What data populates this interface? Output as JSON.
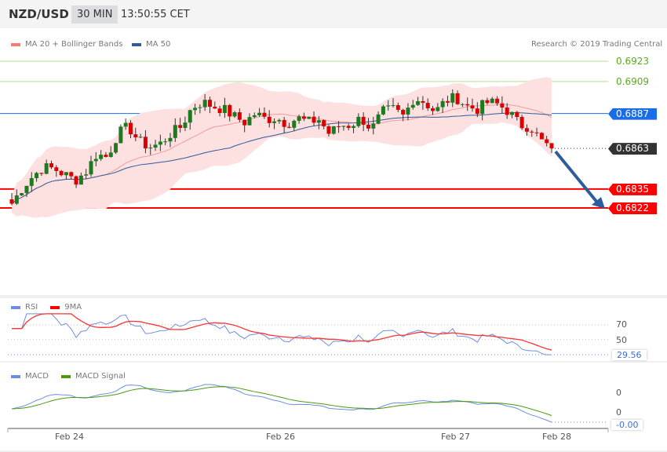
{
  "header": {
    "symbol": "NZD/USD",
    "timeframe": "30 MIN",
    "time": "13:50:55 CET"
  },
  "legend": {
    "ma20": "MA 20 + Bollinger Bands",
    "ma50": "MA 50",
    "copyright": "Research © 2019 Trading Central"
  },
  "levels": [
    {
      "label": "0.6923",
      "value": 0.6923,
      "type": "resistance",
      "color": "#5aaa1e"
    },
    {
      "label": "0.6909",
      "value": 0.6909,
      "type": "resistance",
      "color": "#5aaa1e"
    },
    {
      "label": "0.6887",
      "value": 0.6887,
      "type": "pivot",
      "color": "#1a6de8"
    },
    {
      "label": "0.6863",
      "value": 0.6863,
      "type": "last",
      "color": "#333333"
    },
    {
      "label": "0.6835",
      "value": 0.6835,
      "type": "support",
      "color": "#ff0000"
    },
    {
      "label": "0.6822",
      "value": 0.6822,
      "type": "support",
      "color": "#ff0000"
    }
  ],
  "rsi": {
    "legend_rsi": "RSI",
    "legend_ma": "9MA",
    "level70": "70",
    "level50": "50",
    "value": "29.56"
  },
  "macd": {
    "legend_macd": "MACD",
    "legend_signal": "MACD Signal",
    "tick_top": "0",
    "tick_bottom": "0",
    "value": "-0.00"
  },
  "xaxis": {
    "labels": [
      "Feb 24",
      "Feb 26",
      "Feb 27",
      "Feb 28"
    ]
  },
  "chart_data": {
    "type": "candlestick",
    "title": "NZD/USD 30 MIN",
    "ylim": [
      0.68,
      0.6935
    ],
    "closes": [
      0.6825,
      0.6836,
      0.6844,
      0.685,
      0.6849,
      0.6845,
      0.6841,
      0.6847,
      0.6859,
      0.6857,
      0.6873,
      0.6878,
      0.6868,
      0.6864,
      0.6866,
      0.6873,
      0.6878,
      0.6891,
      0.6895,
      0.6892,
      0.689,
      0.6885,
      0.6881,
      0.6887,
      0.6883,
      0.6884,
      0.688,
      0.6884,
      0.6881,
      0.6883,
      0.6873,
      0.6879,
      0.6879,
      0.6884,
      0.6876,
      0.6888,
      0.689,
      0.6885,
      0.6898,
      0.6895,
      0.6888,
      0.6896,
      0.6898,
      0.6892,
      0.689,
      0.6895,
      0.6893,
      0.6888,
      0.6879,
      0.6878,
      0.6868,
      0.6863
    ],
    "forecast_arrow": {
      "from": 0.6863,
      "to": 0.6822,
      "direction": "down"
    }
  }
}
